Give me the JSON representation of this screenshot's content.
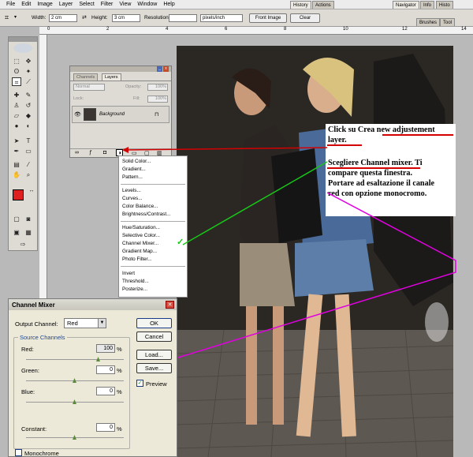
{
  "menubar": {
    "items": [
      "File",
      "Edit",
      "Image",
      "Layer",
      "Select",
      "Filter",
      "View",
      "Window",
      "Help"
    ]
  },
  "options": {
    "width_label": "Width:",
    "width_value": "2 cm",
    "height_label": "Height:",
    "height_value": "3 cm",
    "resolution_label": "Resolution:",
    "resolution_unit": "pixels/inch",
    "front_image": "Front Image",
    "clear": "Clear",
    "tabs": [
      "History",
      "Actions",
      "Navigator",
      "Info",
      "Histo",
      "Brushes",
      "Tool"
    ]
  },
  "ruler": {
    "ticks": [
      "0",
      "2",
      "4",
      "6",
      "8",
      "10",
      "12",
      "14"
    ]
  },
  "layers_panel": {
    "tabs": [
      "Channels",
      "Layers"
    ],
    "blend_mode": "Normal",
    "opacity_label": "Opacity:",
    "opacity_value": "100%",
    "lock_label": "Lock:",
    "fill_label": "Fill:",
    "fill_value": "100%",
    "layer_name": "Background"
  },
  "adjust_menu": {
    "items": [
      "Solid Color...",
      "Gradient...",
      "Pattern...",
      "Levels...",
      "Curves...",
      "Color Balance...",
      "Brightness/Contrast...",
      "Hue/Saturation...",
      "Selective Color...",
      "Channel Mixer...",
      "Gradient Map...",
      "Photo Filter...",
      "Invert",
      "Threshold...",
      "Posterize..."
    ]
  },
  "annotation": {
    "lines": [
      "Click su Crea new adjustement",
      "layer.",
      "Scegliere Channel mixer. Ti",
      "compare questa finestra.",
      "Portare ad esaltazione il canale",
      "red con opzione monocromo."
    ],
    "colors": {
      "red": "#d40000",
      "green": "#18c818",
      "magenta": "#e000e0"
    }
  },
  "channel_mixer": {
    "title": "Channel Mixer",
    "output_label": "Output Channel:",
    "output_value": "Red",
    "group_label": "Source Channels",
    "red_label": "Red:",
    "red_value": "100",
    "green_label": "Green:",
    "green_value": "0",
    "blue_label": "Blue:",
    "blue_value": "0",
    "constant_label": "Constant:",
    "constant_value": "0",
    "percent": "%",
    "ok": "OK",
    "cancel": "Cancel",
    "load": "Load...",
    "save": "Save...",
    "preview_label": "Preview",
    "monochrome_label": "Monochrome",
    "close": "✕"
  }
}
